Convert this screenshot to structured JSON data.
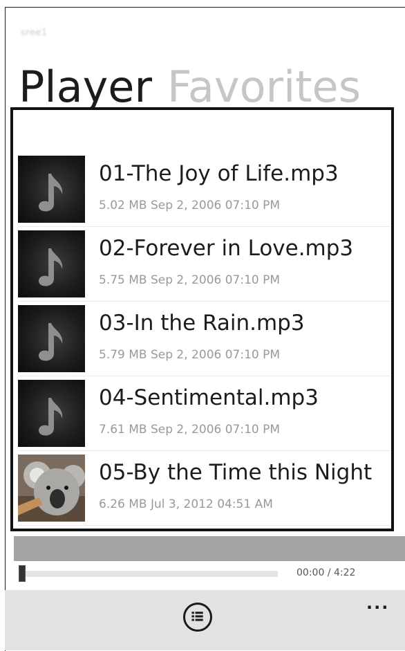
{
  "header": {
    "user": "sree1"
  },
  "pivot": {
    "active": "Player",
    "inactive": "Favorites"
  },
  "list": [
    {
      "title": "01-The Joy of Life.mp3",
      "meta": "5.02 MB Sep 2, 2006 07:10 PM",
      "thumb": "music-note-icon"
    },
    {
      "title": "02-Forever in Love.mp3",
      "meta": "5.75 MB Sep 2, 2006 07:10 PM",
      "thumb": "music-note-icon"
    },
    {
      "title": "03-In the Rain.mp3",
      "meta": "5.79 MB Sep 2, 2006 07:10 PM",
      "thumb": "music-note-icon"
    },
    {
      "title": "04-Sentimental.mp3",
      "meta": "7.61 MB Sep 2, 2006 07:10 PM",
      "thumb": "music-note-icon"
    },
    {
      "title": "05-By the Time this Night",
      "meta": "6.26 MB Jul 3, 2012 04:51 AM",
      "thumb": "koala-photo"
    }
  ],
  "player": {
    "current_time": "00:00",
    "total_time": "/ 4:22",
    "progress": 0
  },
  "appbar": {
    "button_icon": "playlist-icon",
    "more": "..."
  },
  "colors": {
    "accent": "#1c1c1c",
    "band": "#a4a4a4",
    "appbar": "#e2e2e2"
  }
}
